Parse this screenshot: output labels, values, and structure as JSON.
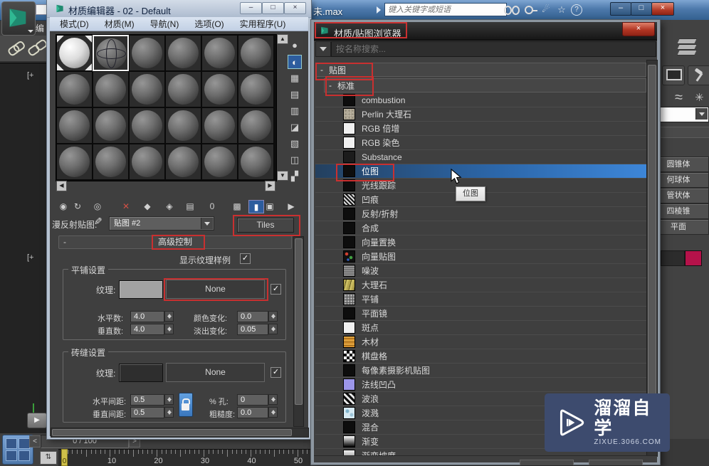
{
  "icons": {
    "minimize": "–",
    "maximize": "□",
    "close": "×",
    "left_arrow": "◀",
    "right_arrow": "▶",
    "up_arrow": "▲",
    "down_arrow": "▼",
    "check": "✓",
    "eyedropper": "✎",
    "star": "☆",
    "help": "?",
    "track_toggle": "⇅",
    "waves": "≈",
    "asterisk": "✳"
  },
  "top_bar": {
    "document_title": "未.max",
    "search_placeholder": "键入关键字或短语"
  },
  "left_strip": {
    "partial_menu": "编",
    "viewport_label_top": "[+",
    "viewport_label_bottom": "[+"
  },
  "material_editor": {
    "title": "材质编辑器 - 02 - Default",
    "menus": [
      {
        "label": "模式(D)"
      },
      {
        "label": "材质(M)"
      },
      {
        "label": "导航(N)"
      },
      {
        "label": "选项(O)"
      },
      {
        "label": "实用程序(U)"
      }
    ],
    "toolbar_icons": [
      {
        "name": "get-material",
        "glyph": "◉"
      },
      {
        "name": "put-material-to-scene",
        "glyph": "↻"
      },
      {
        "name": "assign-material-to-selection",
        "glyph": "◎"
      },
      {
        "name": "reset-map",
        "glyph": "✕",
        "color": "#d05045"
      },
      {
        "name": "make-material-copy",
        "glyph": "◆"
      },
      {
        "name": "make-unique",
        "glyph": "◈"
      },
      {
        "name": "put-to-library",
        "glyph": "▤"
      },
      {
        "name": "material-id-channel",
        "glyph": "0"
      },
      {
        "name": "show-map-in-viewport",
        "glyph": "▩"
      },
      {
        "name": "show-end-result",
        "glyph": "▮",
        "active": true
      },
      {
        "name": "go-to-parent",
        "glyph": "▣"
      },
      {
        "name": "go-forward-same-level",
        "glyph": "▶"
      }
    ],
    "side_icons": [
      {
        "name": "sample-type",
        "glyph": "●"
      },
      {
        "name": "backlight",
        "glyph": "◐",
        "active": true
      },
      {
        "name": "background",
        "glyph": "▦"
      },
      {
        "name": "sample-uv-tiling",
        "glyph": "▤"
      },
      {
        "name": "video-color-check",
        "glyph": "▥"
      },
      {
        "name": "make-preview",
        "glyph": "◪"
      },
      {
        "name": "material-editor-options",
        "glyph": "▧"
      },
      {
        "name": "select-by-material",
        "glyph": "◫"
      },
      {
        "name": "material-map-navigator",
        "glyph": "▞"
      }
    ],
    "diffuse_label": "漫反射贴图:",
    "map_slot_value": "贴图 #2",
    "tiles_button": "Tiles",
    "rollout_collapse": "-",
    "rollout_title": "高级控制",
    "show_sample_label": "显示纹理样例",
    "tiling_group": {
      "title": "平铺设置",
      "texture_label": "纹理:",
      "none_button": "None",
      "fields": [
        {
          "label": "水平数:",
          "value": "4.0"
        },
        {
          "label": "颜色变化:",
          "value": "0.0"
        },
        {
          "label": "垂直数:",
          "value": "4.0"
        },
        {
          "label": "淡出变化:",
          "value": "0.05"
        }
      ]
    },
    "grout_group": {
      "title": "砖缝设置",
      "texture_label": "纹理:",
      "none_button": "None",
      "fields": [
        {
          "label": "水平间距:",
          "value": "0.5"
        },
        {
          "label": "% 孔:",
          "value": "0"
        },
        {
          "label": "垂直间距:",
          "value": "0.5"
        },
        {
          "label": "粗糙度:",
          "value": "0.0"
        }
      ]
    }
  },
  "browser": {
    "title": "材质/贴图浏览器",
    "search_placeholder": "按名称搜索...",
    "group_collapse": "-",
    "group_label": "贴图",
    "subgroup_collapse": "-",
    "subgroup_label": "标准",
    "tooltip": "位图",
    "items": [
      {
        "label": "combustion",
        "swatch": "black"
      },
      {
        "label": "Perlin 大理石",
        "swatch": "marble"
      },
      {
        "label": "RGB 倍增",
        "swatch": "white"
      },
      {
        "label": "RGB 染色",
        "swatch": "white"
      },
      {
        "label": "Substance",
        "swatch": "dark"
      },
      {
        "label": "位图",
        "swatch": "black",
        "selected": true
      },
      {
        "label": "光线跟踪",
        "swatch": "black"
      },
      {
        "label": "凹痕",
        "swatch": "dent"
      },
      {
        "label": "反射/折射",
        "swatch": "black"
      },
      {
        "label": "合成",
        "swatch": "black"
      },
      {
        "label": "向量置换",
        "swatch": "black"
      },
      {
        "label": "向量贴图",
        "swatch": "vector"
      },
      {
        "label": "噪波",
        "swatch": "gnoise"
      },
      {
        "label": "大理石",
        "swatch": "marbley"
      },
      {
        "label": "平铺",
        "swatch": "grid"
      },
      {
        "label": "平面镜",
        "swatch": "black"
      },
      {
        "label": "斑点",
        "swatch": "white"
      },
      {
        "label": "木材",
        "swatch": "wood"
      },
      {
        "label": "棋盘格",
        "swatch": "checker"
      },
      {
        "label": "每像素摄影机贴图",
        "swatch": "black"
      },
      {
        "label": "法线凹凸",
        "swatch": "purple"
      },
      {
        "label": "波浪",
        "swatch": "stripes"
      },
      {
        "label": "泼溅",
        "swatch": "splat"
      },
      {
        "label": "混合",
        "swatch": "black"
      },
      {
        "label": "渐变",
        "swatch": "grad"
      },
      {
        "label": "渐变坡度",
        "swatch": "gradr"
      }
    ]
  },
  "right_panel": {
    "primitive_buttons": [
      {
        "label": "圆锥体"
      },
      {
        "label": "何球体"
      },
      {
        "label": "管状体"
      },
      {
        "label": "四棱锥"
      },
      {
        "label": "平面"
      }
    ],
    "swatch_color": "#b5124a"
  },
  "timeline": {
    "prev": "<",
    "frame_display": "0 / 100",
    "next": ">",
    "marker_label": "0",
    "ruler_labels": [
      {
        "label": "10"
      },
      {
        "label": "20"
      },
      {
        "label": "30"
      },
      {
        "label": "40"
      },
      {
        "label": "50"
      }
    ]
  },
  "watermark": {
    "title": "溜溜自学",
    "url": "ZIXUE.3066.COM",
    "bg_color": "#3d4b6e"
  },
  "colors": {
    "selection_blue": "#2c67aa",
    "annotation_red": "#c93030"
  }
}
